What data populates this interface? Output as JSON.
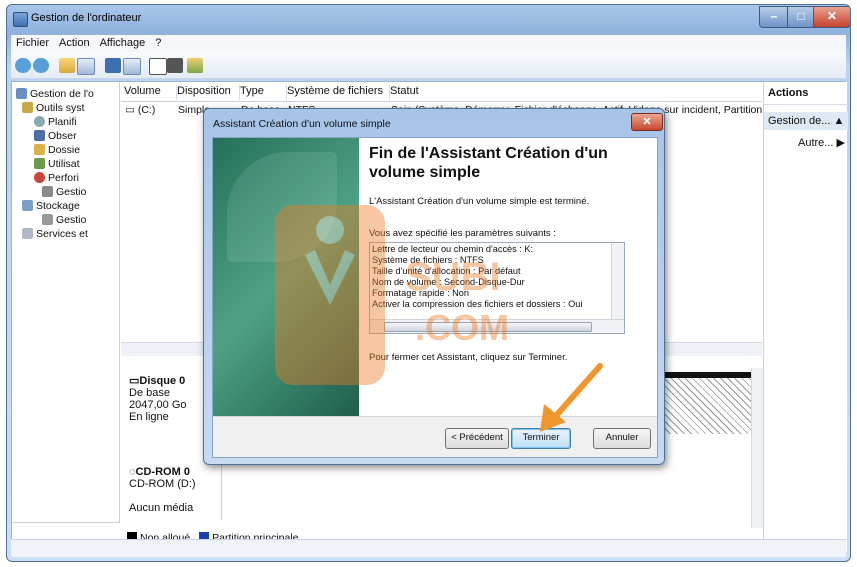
{
  "window": {
    "title": "Gestion de l'ordinateur",
    "min_icon": "minimize-icon",
    "max_icon": "maximize-icon",
    "close_icon": "close-icon"
  },
  "menu": [
    "Fichier",
    "Action",
    "Affichage",
    "?"
  ],
  "tree": {
    "root": "Gestion de l'o",
    "tools": "Outils syst",
    "items": [
      "Planifi",
      "Obser",
      "Dossie",
      "Utilisat",
      "Perfori",
      "Gestio"
    ],
    "storage": "Stockage",
    "storage_child": "Gestio",
    "services": "Services et"
  },
  "columns": [
    "Volume",
    "Disposition",
    "Type",
    "Système de fichiers",
    "Statut"
  ],
  "row1": {
    "volume": "(C:)",
    "layout": "Simple",
    "type": "De base",
    "fs": "NTFS",
    "status": "Sain (Système, Démarrer, Fichier d'échange, Actif, Vidage sur incident, Partition"
  },
  "disk0": {
    "name": "Disque 0",
    "kind": "De base",
    "size": "2047,00 Go",
    "state": "En ligne"
  },
  "cdrom": {
    "name": "CD-ROM 0",
    "drive": "CD-ROM (D:)",
    "media": "Aucun média"
  },
  "legend": {
    "unallocated": "Non alloué",
    "primary": "Partition principale"
  },
  "actions": {
    "header": "Actions",
    "item1": "Gestion de...",
    "item2": "Autre..."
  },
  "dialog": {
    "title": "Assistant Création d'un volume simple",
    "heading": "Fin de l'Assistant Création d'un volume simple",
    "done": "L'Assistant Création d'un volume simple est terminé.",
    "specified": "Vous avez spécifié les paramètres suivants :",
    "params": [
      "Lettre de lecteur ou chemin d'accès : K:",
      "Système de fichiers : NTFS",
      "Taille d'unité d'allocation : Par défaut",
      "Nom de volume : Second-Disque-Dur",
      "Formatage rapide : Non",
      "Activer la compression des fichiers et dossiers : Oui"
    ],
    "close_info": "Pour fermer cet Assistant, cliquez sur Terminer.",
    "btn_prev": "< Précédent",
    "btn_finish": "Terminer",
    "btn_cancel": "Annuler"
  },
  "watermark": {
    "line1": "SUBI",
    "line2": ".COM"
  },
  "colors": {
    "accent": "#3c7fb1",
    "arrow": "#f0962a",
    "watermark": "#f07a1f"
  }
}
